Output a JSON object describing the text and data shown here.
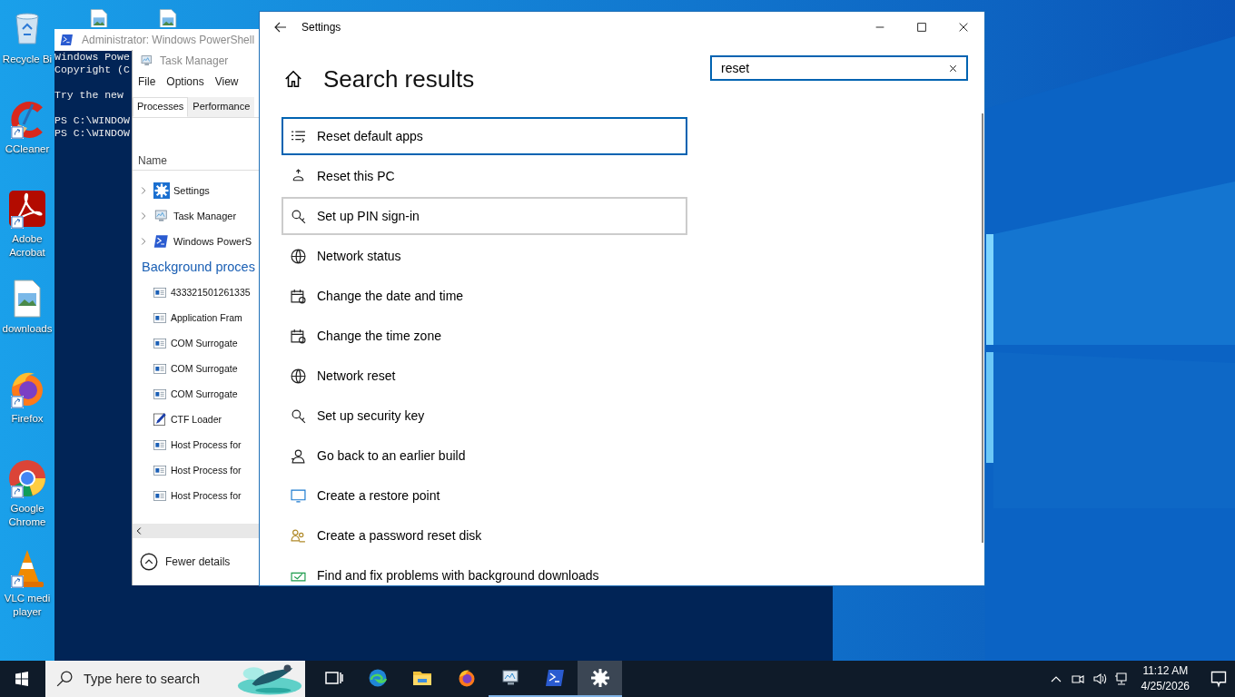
{
  "desktop_icons": [
    {
      "label": "Recycle Bi",
      "kind": "bin",
      "shortcut": false
    },
    {
      "label": "CCleaner",
      "kind": "cleaner",
      "shortcut": true
    },
    {
      "label": "Adobe Acrobat",
      "kind": "pdf",
      "shortcut": true
    },
    {
      "label": "downloads",
      "shortcut": false
    },
    {
      "label": "Firefox",
      "kind": "firefox",
      "shortcut": true
    },
    {
      "label": "Google Chrome",
      "kind": "chrome",
      "shortcut": true
    },
    {
      "label": "VLC medi player",
      "kind": "cone",
      "shortcut": true
    }
  ],
  "powershell": {
    "title": "Administrator: Windows PowerShell",
    "paragraphs": [
      [
        "Windows Powe",
        "Copyright (C"
      ],
      [
        "Try the new"
      ],
      [
        "PS C:\\WINDOW",
        "PS C:\\WINDOW"
      ]
    ]
  },
  "task_manager": {
    "title": "Task Manager",
    "menu": [
      "File",
      "Options",
      "View"
    ],
    "tabs": [
      {
        "label": "Processes",
        "selected": true
      },
      {
        "label": "Performance",
        "selected": false
      }
    ],
    "column": "Name",
    "apps": [
      {
        "name": "Settings",
        "kind": "gear"
      },
      {
        "name": "Task Manager",
        "kind": "monitor"
      },
      {
        "name": "Windows PowerS",
        "kind": "shell"
      }
    ],
    "background_heading": "Background proces",
    "background": [
      {
        "name": "433321501261335",
        "kind": "window"
      },
      {
        "name": "Application Fram",
        "kind": "window"
      },
      {
        "name": "COM Surrogate",
        "kind": "window"
      },
      {
        "name": "COM Surrogate",
        "kind": "window"
      },
      {
        "name": "COM Surrogate",
        "kind": "window"
      },
      {
        "name": "CTF Loader",
        "kind": "pen"
      },
      {
        "name": "Host Process for",
        "kind": "window"
      },
      {
        "name": "Host Process for",
        "kind": "window"
      },
      {
        "name": "Host Process for",
        "kind": "window"
      }
    ],
    "footer": "Fewer details"
  },
  "settings": {
    "title": "Settings",
    "heading": "Search results",
    "search": {
      "value": "reset"
    },
    "results": [
      {
        "label": "Reset default apps",
        "kind": "list",
        "selected": true,
        "hovered": false
      },
      {
        "label": "Reset this PC",
        "kind": "reset",
        "selected": false,
        "hovered": false
      },
      {
        "label": "Set up PIN sign-in",
        "kind": "key",
        "selected": false,
        "hovered": true
      },
      {
        "label": "Network status",
        "kind": "globe",
        "selected": false,
        "hovered": false
      },
      {
        "label": "Change the date and time",
        "kind": "calendar",
        "selected": false,
        "hovered": false
      },
      {
        "label": "Change the time zone",
        "kind": "calendar",
        "selected": false,
        "hovered": false
      },
      {
        "label": "Network reset",
        "kind": "globe",
        "selected": false,
        "hovered": false
      },
      {
        "label": "Set up security key",
        "kind": "key",
        "selected": false,
        "hovered": false
      },
      {
        "label": "Go back to an earlier build",
        "kind": "person",
        "selected": false,
        "hovered": false
      },
      {
        "label": "Create a restore point",
        "kind": "screen",
        "selected": false,
        "hovered": false
      },
      {
        "label": "Create a password reset disk",
        "kind": "people",
        "selected": false,
        "hovered": false
      },
      {
        "label": "Find and fix problems with background downloads",
        "kind": "wrench",
        "selected": false,
        "hovered": false
      }
    ]
  },
  "taskbar": {
    "search_placeholder": "Type here to search",
    "apps": [
      {
        "kind": "taskview",
        "running": false,
        "active": false
      },
      {
        "kind": "edge",
        "running": false,
        "active": false
      },
      {
        "kind": "folder",
        "running": false,
        "active": false
      },
      {
        "kind": "firefox",
        "running": false,
        "active": false
      },
      {
        "kind": "monitor",
        "running": true,
        "active": false
      },
      {
        "kind": "shell",
        "running": true,
        "active": false
      },
      {
        "kind": "gear",
        "running": true,
        "active": true
      }
    ],
    "time": "11:12 AM",
    "date": "4/25/2026"
  }
}
